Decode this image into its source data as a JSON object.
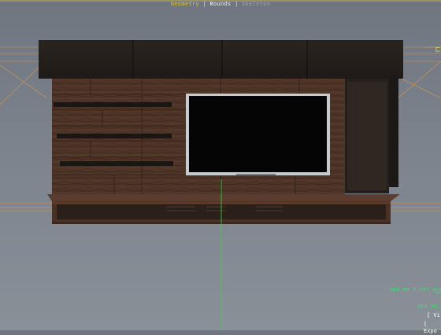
{
  "hud": {
    "geometry_label": "Geometry",
    "bounds_label": "Bounds",
    "skeleton_label": "Skeleton",
    "separator": "|"
  },
  "scene": {
    "object_name": "apa_mp_h_str_avu",
    "object_name_short": "apa_mp_",
    "view_label": "[ Vi",
    "export_label": "[ Expo"
  },
  "colors": {
    "background": "#777e88",
    "wood": "#4e3427",
    "dark_panel": "#2c241e",
    "screen": "#050505",
    "grid_orange": "#e09040",
    "axis_green": "#3cd04a",
    "selection_text": "#3edc72"
  }
}
